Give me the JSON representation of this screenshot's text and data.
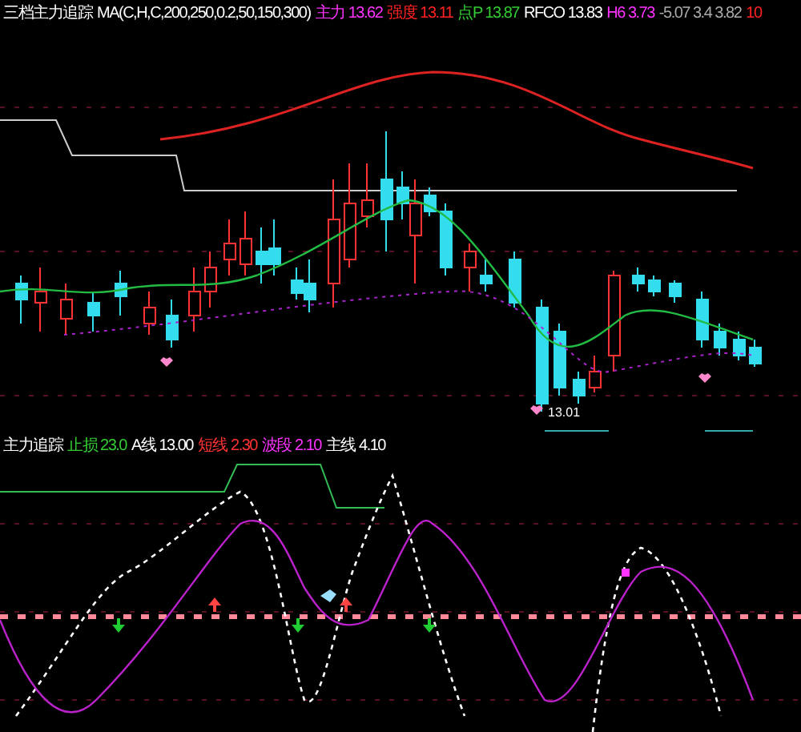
{
  "header": [
    {
      "text": "三档主力追踪",
      "color": "#ffffff"
    },
    {
      "text": "MA(C,H,C,200,250,0.2,50,150,300)",
      "color": "#ffffff"
    },
    {
      "text": "主力 13.62",
      "color": "#ff33ff"
    },
    {
      "text": "强度 13.11",
      "color": "#ff2222"
    },
    {
      "text": "点P 13.87",
      "color": "#33cc33"
    },
    {
      "text": "RFCO 13.83",
      "color": "#ffffff"
    },
    {
      "text": "H6 3.73",
      "color": "#ff33ff"
    },
    {
      "text": "-5.07 3.4 3.82",
      "color": "#aaaaaa"
    },
    {
      "text": "10",
      "color": "#ff2222"
    }
  ],
  "price_label": "13.01",
  "indicator_legend": [
    {
      "text": "主力追踪",
      "color": "#ffffff"
    },
    {
      "text": "止损 23.0",
      "color": "#33cc33"
    },
    {
      "text": "A线 13.00",
      "color": "#ffffff"
    },
    {
      "text": "短线 2.30",
      "color": "#ff3333"
    },
    {
      "text": "波段 2.10",
      "color": "#ff33ff"
    },
    {
      "text": "主线 4.10",
      "color": "#ffffff"
    }
  ]
}
